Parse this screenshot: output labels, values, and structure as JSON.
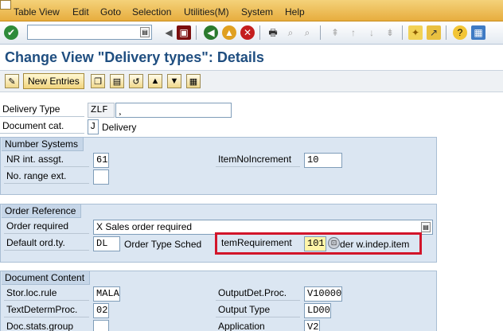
{
  "menu": [
    "Table View",
    "Edit",
    "Goto",
    "Selection",
    "Utilities(M)",
    "System",
    "Help"
  ],
  "toolbar": {
    "icons": [
      "enter-icon",
      "command-field-icon",
      "back-icon",
      "save-icon",
      "exit-icon",
      "cancel-icon",
      "print-icon",
      "find-icon",
      "find-next-icon",
      "first-page-icon",
      "previous-page-icon",
      "next-page-icon",
      "last-page-icon",
      "create-session-icon",
      "shortcut-icon",
      "help-icon",
      "customize-layout-icon"
    ]
  },
  "page": {
    "title": "Change View \"Delivery types\": Details"
  },
  "app_toolbar": {
    "new_entries_label": "New Entries"
  },
  "header": {
    "delivery_type_label": "Delivery Type",
    "delivery_type_value": "ZLF",
    "delivery_type_desc": "¸",
    "document_cat_label": "Document cat.",
    "document_cat_value": "J",
    "document_cat_text": "Delivery"
  },
  "number_systems": {
    "title": "Number Systems",
    "nr_int_assgt_label": "NR int. assgt.",
    "nr_int_assgt_value": "61",
    "item_no_increment_label": "ItemNoIncrement",
    "item_no_increment_value": "10",
    "no_range_ext_label": "No. range ext.",
    "no_range_ext_value": ""
  },
  "order_reference": {
    "title": "Order Reference",
    "order_required_label": "Order required",
    "order_required_value": "X Sales order required",
    "default_ord_ty_label": "Default ord.ty.",
    "default_ord_ty_value": "DL",
    "order_type_sched_label": "Order Type Sched",
    "item_requirement_label": "temRequirement",
    "item_requirement_value": "101",
    "item_requirement_text": "der w.indep.item"
  },
  "document_content": {
    "title": "Document Content",
    "stor_loc_rule_label": "Stor.loc.rule",
    "stor_loc_rule_value": "MALA",
    "output_det_proc_label": "OutputDet.Proc.",
    "output_det_proc_value": "V10000",
    "text_determ_proc_label": "TextDetermProc.",
    "text_determ_proc_value": "02",
    "output_type_label": "Output Type",
    "output_type_value": "LD00",
    "doc_stats_group_label": "Doc.stats.group",
    "doc_stats_group_value": "",
    "application_label": "Application",
    "application_value": "V2"
  },
  "colors": {
    "menubar": "#e9b548",
    "title": "#1f4e80",
    "group_bg": "#dbe6f2",
    "highlight": "#d2152a"
  }
}
